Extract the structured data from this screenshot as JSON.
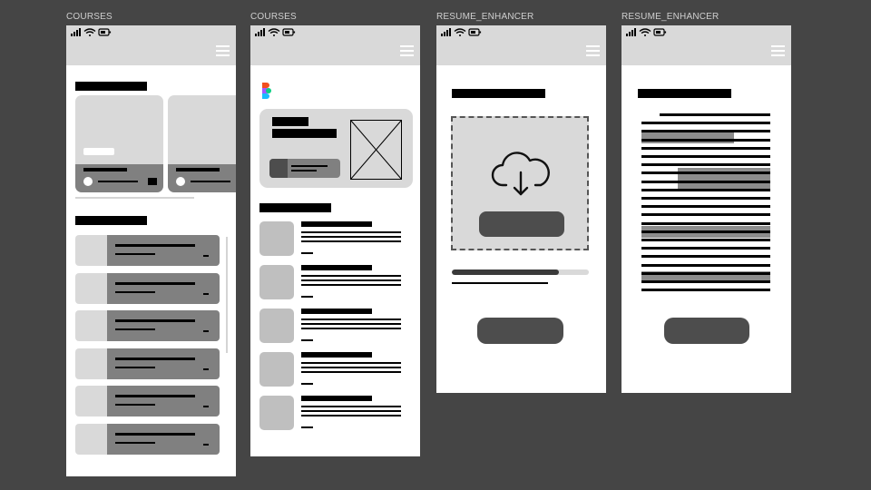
{
  "frames": [
    {
      "label": "COURSES"
    },
    {
      "label": "COURSES"
    },
    {
      "label": "RESUME_ENHANCER"
    },
    {
      "label": "RESUME_ENHANCER"
    }
  ],
  "colors": {
    "canvas": "#454545",
    "statusbar": "#d9d9d9",
    "card_placeholder": "#d9d9d9",
    "card_footer": "#808080",
    "list_accent": "#808080",
    "button": "#4d4d4d",
    "progress_fill": "#3a3a3a",
    "highlight": "#8c8c8c"
  },
  "icons": {
    "statusbar": [
      "signal-icon",
      "wifi-icon",
      "battery-icon"
    ],
    "menu": "hamburger-menu-icon",
    "logo": "app-logo-icon",
    "upload": "cloud-download-icon",
    "image_placeholder": "image-placeholder-icon"
  },
  "upload": {
    "progress": 0.78
  }
}
